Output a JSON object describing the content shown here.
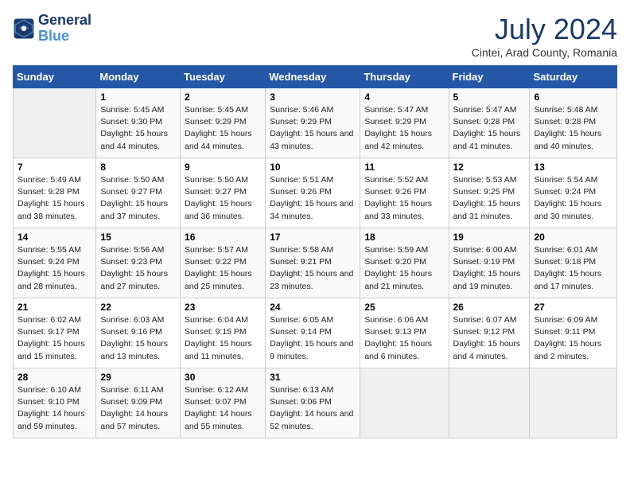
{
  "logo": {
    "line1": "General",
    "line2": "Blue"
  },
  "title": "July 2024",
  "subtitle": "Cintei, Arad County, Romania",
  "days_of_week": [
    "Sunday",
    "Monday",
    "Tuesday",
    "Wednesday",
    "Thursday",
    "Friday",
    "Saturday"
  ],
  "weeks": [
    [
      {
        "day": "",
        "sunrise": "",
        "sunset": "",
        "daylight": ""
      },
      {
        "day": "1",
        "sunrise": "Sunrise: 5:45 AM",
        "sunset": "Sunset: 9:30 PM",
        "daylight": "Daylight: 15 hours and 44 minutes."
      },
      {
        "day": "2",
        "sunrise": "Sunrise: 5:45 AM",
        "sunset": "Sunset: 9:29 PM",
        "daylight": "Daylight: 15 hours and 44 minutes."
      },
      {
        "day": "3",
        "sunrise": "Sunrise: 5:46 AM",
        "sunset": "Sunset: 9:29 PM",
        "daylight": "Daylight: 15 hours and 43 minutes."
      },
      {
        "day": "4",
        "sunrise": "Sunrise: 5:47 AM",
        "sunset": "Sunset: 9:29 PM",
        "daylight": "Daylight: 15 hours and 42 minutes."
      },
      {
        "day": "5",
        "sunrise": "Sunrise: 5:47 AM",
        "sunset": "Sunset: 9:28 PM",
        "daylight": "Daylight: 15 hours and 41 minutes."
      },
      {
        "day": "6",
        "sunrise": "Sunrise: 5:48 AM",
        "sunset": "Sunset: 9:28 PM",
        "daylight": "Daylight: 15 hours and 40 minutes."
      }
    ],
    [
      {
        "day": "7",
        "sunrise": "Sunrise: 5:49 AM",
        "sunset": "Sunset: 9:28 PM",
        "daylight": "Daylight: 15 hours and 38 minutes."
      },
      {
        "day": "8",
        "sunrise": "Sunrise: 5:50 AM",
        "sunset": "Sunset: 9:27 PM",
        "daylight": "Daylight: 15 hours and 37 minutes."
      },
      {
        "day": "9",
        "sunrise": "Sunrise: 5:50 AM",
        "sunset": "Sunset: 9:27 PM",
        "daylight": "Daylight: 15 hours and 36 minutes."
      },
      {
        "day": "10",
        "sunrise": "Sunrise: 5:51 AM",
        "sunset": "Sunset: 9:26 PM",
        "daylight": "Daylight: 15 hours and 34 minutes."
      },
      {
        "day": "11",
        "sunrise": "Sunrise: 5:52 AM",
        "sunset": "Sunset: 9:26 PM",
        "daylight": "Daylight: 15 hours and 33 minutes."
      },
      {
        "day": "12",
        "sunrise": "Sunrise: 5:53 AM",
        "sunset": "Sunset: 9:25 PM",
        "daylight": "Daylight: 15 hours and 31 minutes."
      },
      {
        "day": "13",
        "sunrise": "Sunrise: 5:54 AM",
        "sunset": "Sunset: 9:24 PM",
        "daylight": "Daylight: 15 hours and 30 minutes."
      }
    ],
    [
      {
        "day": "14",
        "sunrise": "Sunrise: 5:55 AM",
        "sunset": "Sunset: 9:24 PM",
        "daylight": "Daylight: 15 hours and 28 minutes."
      },
      {
        "day": "15",
        "sunrise": "Sunrise: 5:56 AM",
        "sunset": "Sunset: 9:23 PM",
        "daylight": "Daylight: 15 hours and 27 minutes."
      },
      {
        "day": "16",
        "sunrise": "Sunrise: 5:57 AM",
        "sunset": "Sunset: 9:22 PM",
        "daylight": "Daylight: 15 hours and 25 minutes."
      },
      {
        "day": "17",
        "sunrise": "Sunrise: 5:58 AM",
        "sunset": "Sunset: 9:21 PM",
        "daylight": "Daylight: 15 hours and 23 minutes."
      },
      {
        "day": "18",
        "sunrise": "Sunrise: 5:59 AM",
        "sunset": "Sunset: 9:20 PM",
        "daylight": "Daylight: 15 hours and 21 minutes."
      },
      {
        "day": "19",
        "sunrise": "Sunrise: 6:00 AM",
        "sunset": "Sunset: 9:19 PM",
        "daylight": "Daylight: 15 hours and 19 minutes."
      },
      {
        "day": "20",
        "sunrise": "Sunrise: 6:01 AM",
        "sunset": "Sunset: 9:18 PM",
        "daylight": "Daylight: 15 hours and 17 minutes."
      }
    ],
    [
      {
        "day": "21",
        "sunrise": "Sunrise: 6:02 AM",
        "sunset": "Sunset: 9:17 PM",
        "daylight": "Daylight: 15 hours and 15 minutes."
      },
      {
        "day": "22",
        "sunrise": "Sunrise: 6:03 AM",
        "sunset": "Sunset: 9:16 PM",
        "daylight": "Daylight: 15 hours and 13 minutes."
      },
      {
        "day": "23",
        "sunrise": "Sunrise: 6:04 AM",
        "sunset": "Sunset: 9:15 PM",
        "daylight": "Daylight: 15 hours and 11 minutes."
      },
      {
        "day": "24",
        "sunrise": "Sunrise: 6:05 AM",
        "sunset": "Sunset: 9:14 PM",
        "daylight": "Daylight: 15 hours and 9 minutes."
      },
      {
        "day": "25",
        "sunrise": "Sunrise: 6:06 AM",
        "sunset": "Sunset: 9:13 PM",
        "daylight": "Daylight: 15 hours and 6 minutes."
      },
      {
        "day": "26",
        "sunrise": "Sunrise: 6:07 AM",
        "sunset": "Sunset: 9:12 PM",
        "daylight": "Daylight: 15 hours and 4 minutes."
      },
      {
        "day": "27",
        "sunrise": "Sunrise: 6:09 AM",
        "sunset": "Sunset: 9:11 PM",
        "daylight": "Daylight: 15 hours and 2 minutes."
      }
    ],
    [
      {
        "day": "28",
        "sunrise": "Sunrise: 6:10 AM",
        "sunset": "Sunset: 9:10 PM",
        "daylight": "Daylight: 14 hours and 59 minutes."
      },
      {
        "day": "29",
        "sunrise": "Sunrise: 6:11 AM",
        "sunset": "Sunset: 9:09 PM",
        "daylight": "Daylight: 14 hours and 57 minutes."
      },
      {
        "day": "30",
        "sunrise": "Sunrise: 6:12 AM",
        "sunset": "Sunset: 9:07 PM",
        "daylight": "Daylight: 14 hours and 55 minutes."
      },
      {
        "day": "31",
        "sunrise": "Sunrise: 6:13 AM",
        "sunset": "Sunset: 9:06 PM",
        "daylight": "Daylight: 14 hours and 52 minutes."
      },
      {
        "day": "",
        "sunrise": "",
        "sunset": "",
        "daylight": ""
      },
      {
        "day": "",
        "sunrise": "",
        "sunset": "",
        "daylight": ""
      },
      {
        "day": "",
        "sunrise": "",
        "sunset": "",
        "daylight": ""
      }
    ]
  ]
}
